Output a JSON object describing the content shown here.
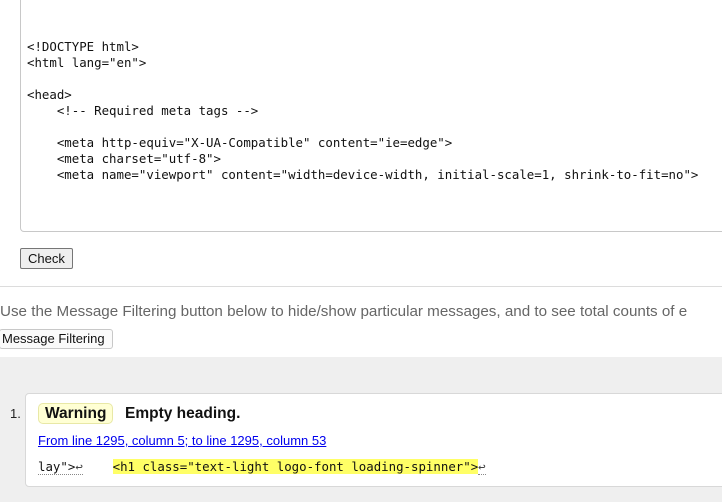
{
  "source": {
    "lines": [
      "<!DOCTYPE html>",
      "<html lang=\"en\">",
      "",
      "<head>",
      "    <!-- Required meta tags -->",
      "",
      "    <meta http-equiv=\"X-UA-Compatible\" content=\"ie=edge\">",
      "    <meta charset=\"utf-8\">",
      "    <meta name=\"viewport\" content=\"width=device-width, initial-scale=1, shrink-to-fit=no\">"
    ]
  },
  "check_button_label": "Check",
  "filtering": {
    "help_text": "Use the Message Filtering button below to hide/show particular messages, and to see total counts of e",
    "button_label": "Message Filtering"
  },
  "messages": [
    {
      "number": "1.",
      "type": "Warning",
      "title": "Empty heading.",
      "location": "From line 1295, column 5; to line 1295, column 53",
      "extract_before": "lay\">",
      "extract_before_return": "↩",
      "extract_highlight": "<h1 class=\"text-light logo-font loading-spinner\">",
      "extract_after_return": "↩"
    }
  ]
}
